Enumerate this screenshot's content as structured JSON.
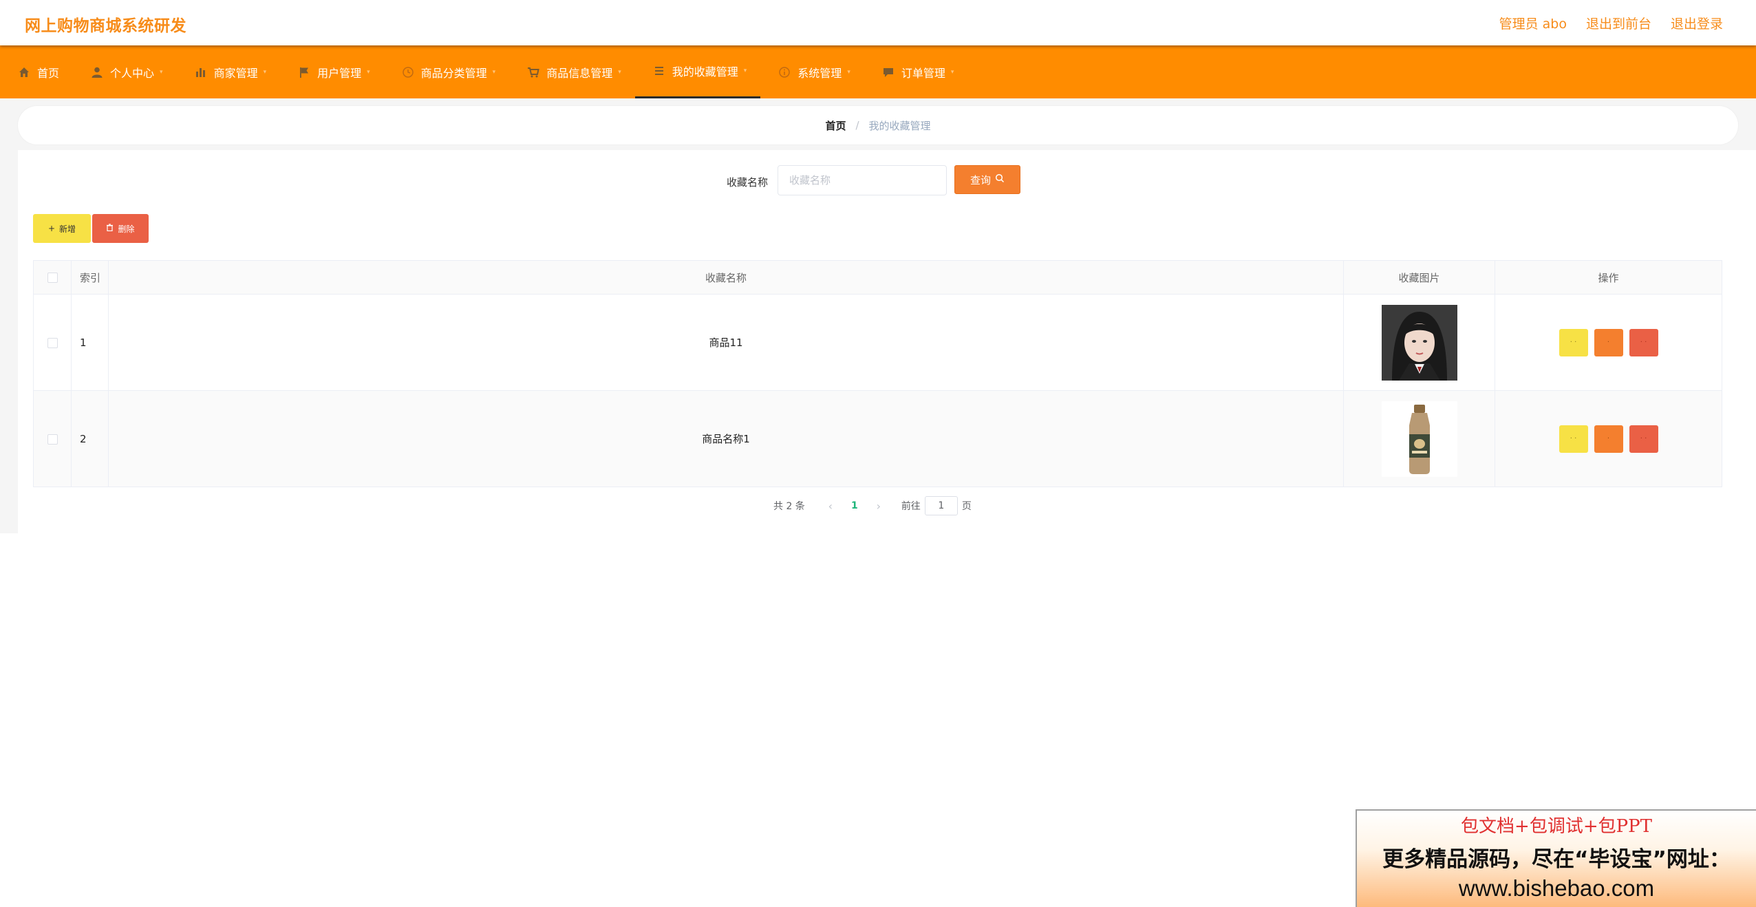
{
  "header": {
    "app_title": "网上购物商城系统研发",
    "admin_label": "管理员 abo",
    "front_link": "退出到前台",
    "logout_link": "退出登录"
  },
  "nav": {
    "items": [
      {
        "label": "首页",
        "icon": "home-icon"
      },
      {
        "label": "个人中心",
        "icon": "user-icon"
      },
      {
        "label": "商家管理",
        "icon": "chart-icon"
      },
      {
        "label": "用户管理",
        "icon": "flag-icon"
      },
      {
        "label": "商品分类管理",
        "icon": "clock-icon"
      },
      {
        "label": "商品信息管理",
        "icon": "cart-icon"
      },
      {
        "label": "我的收藏管理",
        "icon": "list-icon"
      },
      {
        "label": "系统管理",
        "icon": "info-icon"
      },
      {
        "label": "订单管理",
        "icon": "chat-icon"
      }
    ],
    "active": "我的收藏管理",
    "colors": {
      "bar": "#ff8c00",
      "title": "#f78c1a"
    }
  },
  "breadcrumb": {
    "home": "首页",
    "separator": "/",
    "current": "我的收藏管理"
  },
  "search": {
    "label": "收藏名称",
    "placeholder": "收藏名称",
    "value": "",
    "button_label": "查询"
  },
  "actions": {
    "add_label": "新增",
    "delete_label": "删除"
  },
  "table": {
    "headers": {
      "index": "索引",
      "name": "收藏名称",
      "image": "收藏图片",
      "ops": "操作"
    },
    "rows": [
      {
        "index": "1",
        "name": "商品11",
        "image": "portrait-photo"
      },
      {
        "index": "2",
        "name": "商品名称1",
        "image": "bottle-drink-photo"
      }
    ],
    "op_colors": [
      "#f7e145",
      "#f47f2e",
      "#ea6045"
    ]
  },
  "pagination": {
    "total_text": "共 2 条",
    "current_page": "1",
    "goto_prefix": "前往",
    "goto_value": "1",
    "goto_suffix": "页"
  },
  "banner": {
    "line1": "包文档+包调试+包PPT",
    "line2": "更多精品源码，尽在“毕设宝”网址：",
    "line3": "www.bishebao.com"
  }
}
